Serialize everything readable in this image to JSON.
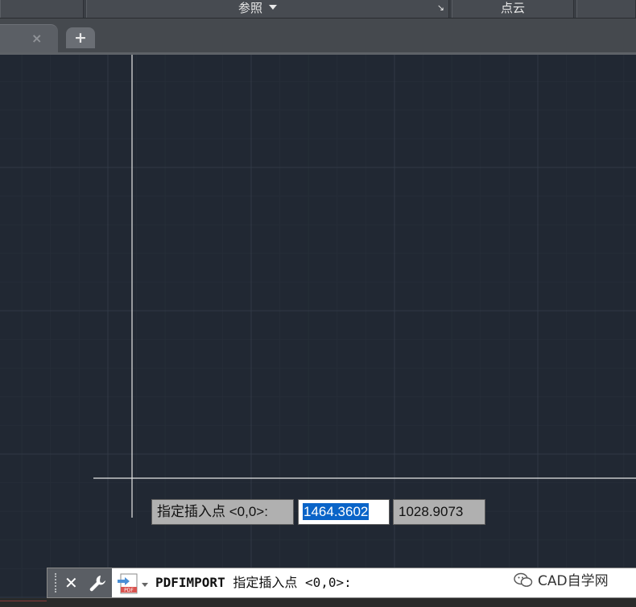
{
  "ribbon": {
    "panels": [
      {
        "label": "参照",
        "has_dropdown": true,
        "has_launcher": true
      },
      {
        "label": "点云"
      }
    ]
  },
  "tabs": {
    "close_glyph": "×",
    "new_tab_glyph": "+"
  },
  "dynamic_input": {
    "prompt": "指定插入点 <0,0>:",
    "x_value": "1464.3602",
    "y_value": "1028.9073"
  },
  "command_line": {
    "close_glyph": "✕",
    "command": "PDFIMPORT",
    "prompt": " 指定插入点 <0,0>:",
    "recent_icon": "pdf-file-icon"
  },
  "watermark": {
    "text": "CAD自学网",
    "icon": "wechat-icon"
  },
  "colors": {
    "canvas_bg": "#212833",
    "selection": "#0a64c8"
  }
}
